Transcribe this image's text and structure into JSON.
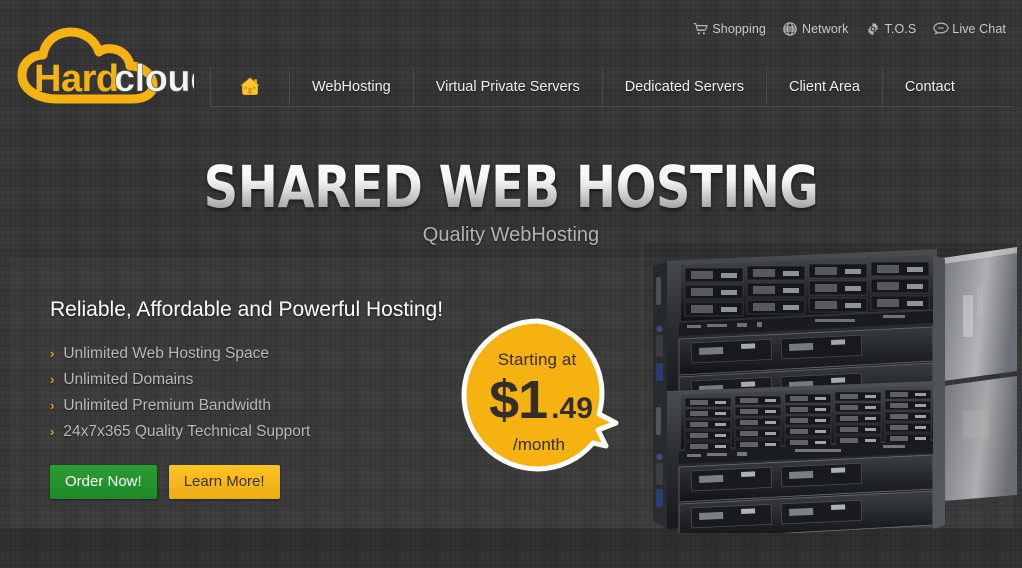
{
  "brand": {
    "name_part1": "Hard",
    "name_part2": "cloud",
    "logo_icon": "cloud-icon",
    "color_primary": "#F5B211",
    "color_secondary": "#FFFFFF"
  },
  "topbar": {
    "items": [
      {
        "label": "Shopping",
        "icon": "shopping-cart-icon"
      },
      {
        "label": "Network",
        "icon": "globe-icon"
      },
      {
        "label": "T.O.S",
        "icon": "gear-icon"
      },
      {
        "label": "Live Chat",
        "icon": "chat-bubble-icon"
      }
    ]
  },
  "nav": {
    "home_icon": "home-icon",
    "items": [
      {
        "label": "WebHosting"
      },
      {
        "label": "Virtual Private Servers"
      },
      {
        "label": "Dedicated Servers"
      },
      {
        "label": "Client Area"
      },
      {
        "label": "Contact"
      }
    ]
  },
  "hero": {
    "title": "SHARED WEB HOSTING",
    "subtitle": "Quality WebHosting"
  },
  "promo": {
    "headline": "Reliable, Affordable and Powerful Hosting!",
    "features": [
      "Unlimited Web Hosting Space",
      "Unlimited Domains",
      "Unlimited Premium Bandwidth",
      "24x7x365 Quality Technical Support"
    ],
    "bullet_glyph": "›",
    "buttons": {
      "order": {
        "label": "Order Now!",
        "color": "#1f8d29"
      },
      "learn": {
        "label": "Learn More!",
        "color": "#f4b519"
      }
    }
  },
  "price_badge": {
    "prefix": "Starting at",
    "currency_amount": "$1",
    "cents": ".49",
    "period": "/month",
    "bg_color": "#F5B211",
    "text_color": "#332F28"
  },
  "media": {
    "hero_image": "rack-servers-photo"
  }
}
